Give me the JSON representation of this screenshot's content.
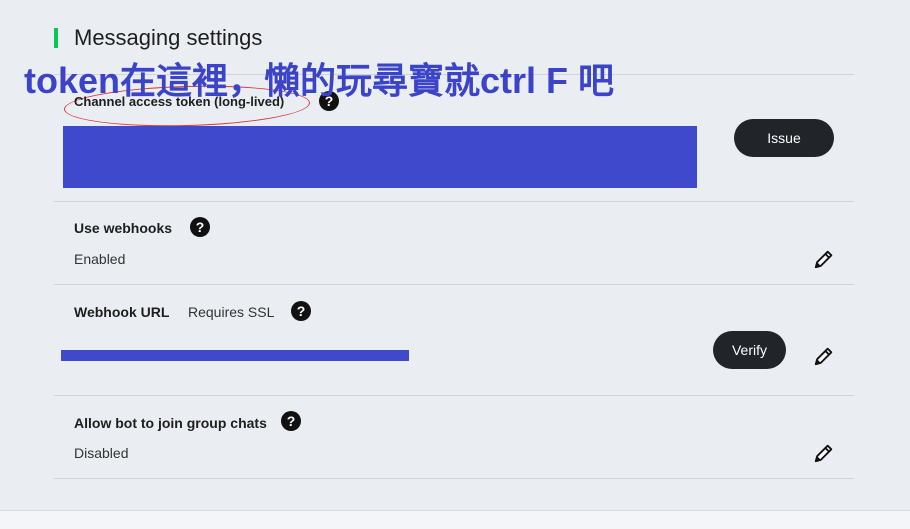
{
  "section": {
    "title": "Messaging settings",
    "accent_color": "#06c755"
  },
  "annotation": {
    "text": "token在這裡，懶的玩尋寶就ctrl F 吧",
    "color": "#3b44c8"
  },
  "channel_token": {
    "label": "Channel access token (long-lived)",
    "help_icon": "question-circle-icon",
    "help_glyph": "?",
    "issue_button_label": "Issue"
  },
  "webhooks": {
    "label": "Use webhooks",
    "help_glyph": "?",
    "value": "Enabled",
    "edit_icon": "pencil-icon"
  },
  "webhook_url": {
    "label": "Webhook URL",
    "sub_label": "Requires SSL",
    "help_glyph": "?",
    "verify_button_label": "Verify",
    "edit_icon": "pencil-icon"
  },
  "group_chats": {
    "label": "Allow bot to join group chats",
    "help_glyph": "?",
    "value": "Disabled",
    "edit_icon": "pencil-icon"
  },
  "redaction_color": "#3f49cb"
}
